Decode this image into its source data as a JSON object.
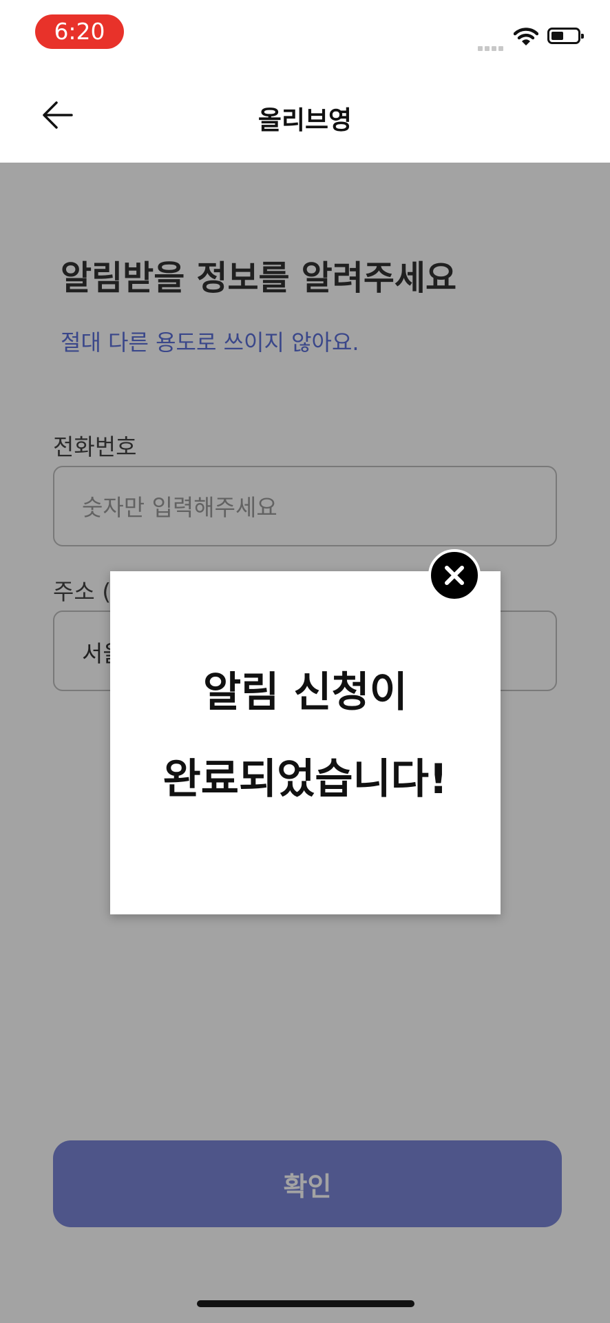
{
  "status_bar": {
    "time": "6:20"
  },
  "nav": {
    "title": "올리브영"
  },
  "form": {
    "heading": "알림받을 정보를 알려주세요",
    "subheading": "절대 다른 용도로 쓰이지 않아요.",
    "phone_label": "전화번호",
    "phone_placeholder": "숫자만 입력해주세요",
    "address_label": "주소 (",
    "address_value": "서울"
  },
  "confirm_button": {
    "label": "확인"
  },
  "modal": {
    "line1": "알림 신청이",
    "line2": "완료되었습니다!"
  },
  "colors": {
    "time_pill": "#e8322a",
    "accent": "#7b86d6",
    "subheading": "#5b6fd8"
  }
}
